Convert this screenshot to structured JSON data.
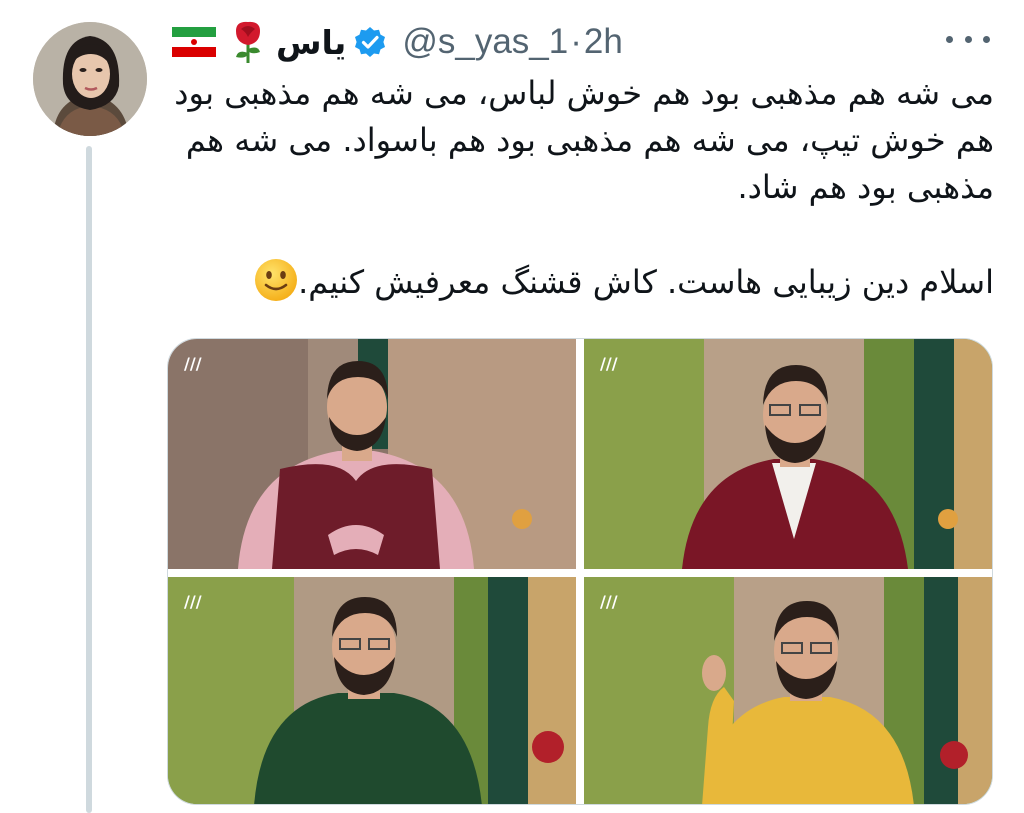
{
  "tweet": {
    "author": {
      "name": "یاس",
      "handle": "@s_yas_1",
      "flag_icon": "iran-flag-icon",
      "rose_icon": "rose-icon",
      "verified_icon": "verified-badge-icon"
    },
    "separator": "·",
    "time": "2h",
    "paragraph_1": "می شه هم مذهبی بود هم خوش لباس، می شه هم مذهبی بود هم خوش تیپ، می شه هم مذهبی بود هم باسواد. می شه هم مذهبی بود هم شاد.",
    "paragraph_2": "اسلام دین زیبایی هاست. کاش قشنگ معرفیش کنیم.",
    "emoji_icon": "slightly-smiling-face-icon",
    "more_icon": "more-options-icon",
    "photos": [
      {
        "sweater": "red-vest"
      },
      {
        "sweater": "maroon-cardigan"
      },
      {
        "sweater": "green-sweater"
      },
      {
        "sweater": "yellow-sweater"
      }
    ]
  },
  "colors": {
    "text": "#0f1419",
    "secondary": "#536471",
    "verified": "#1d9bf0",
    "thread_line": "#cfd9de"
  }
}
